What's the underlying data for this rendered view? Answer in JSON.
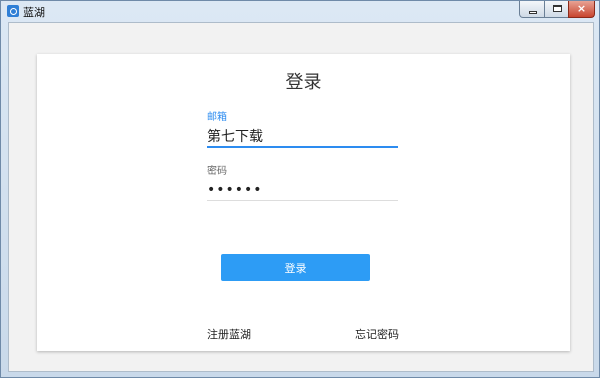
{
  "window": {
    "title": "蓝湖",
    "icon": "lanhu-app-icon",
    "controls": {
      "minimize": "minimize-icon",
      "maximize": "maximize-icon",
      "close": "×"
    }
  },
  "login": {
    "heading": "登录",
    "email": {
      "label": "邮箱",
      "value": "第七下载"
    },
    "password": {
      "label": "密码",
      "value": "••••••"
    },
    "submit_label": "登录",
    "register_link": "注册蓝湖",
    "forgot_link": "忘记密码"
  },
  "colors": {
    "accent": "#2d8cf0",
    "button": "#2d9cf5"
  }
}
